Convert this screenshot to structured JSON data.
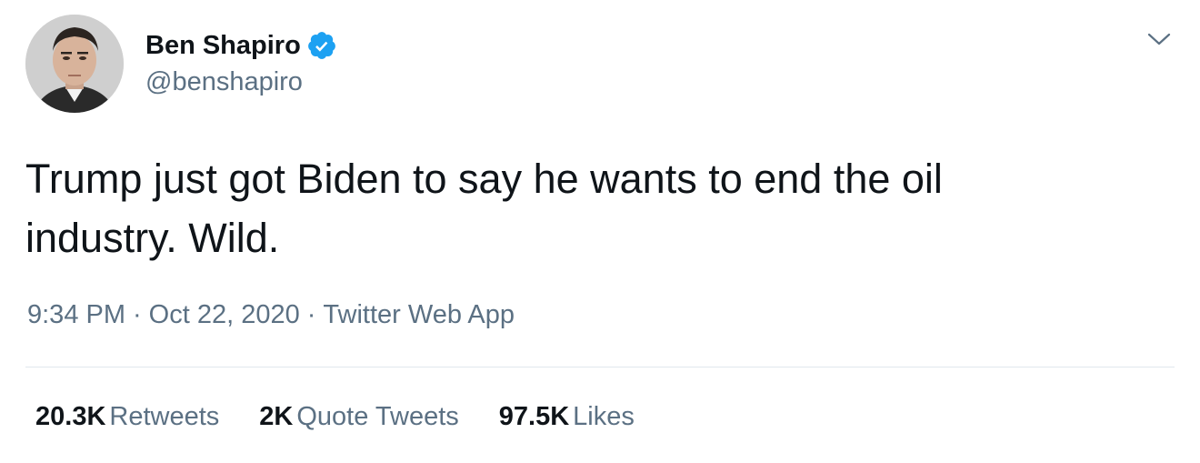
{
  "author": {
    "display_name": "Ben Shapiro",
    "handle": "@benshapiro",
    "verified": true,
    "avatar_icon": "profile-photo"
  },
  "tweet": {
    "text": "Trump just got Biden to say he wants to end the oil\nindustry. Wild.",
    "time": "9:34 PM",
    "date": "Oct 22, 2020",
    "source": "Twitter Web App",
    "separator": "·"
  },
  "stats": {
    "retweets": {
      "count": "20.3K",
      "label": "Retweets"
    },
    "quote_tweets": {
      "count": "2K",
      "label": "Quote Tweets"
    },
    "likes": {
      "count": "97.5K",
      "label": "Likes"
    }
  },
  "icons": {
    "verified": "verified-badge-icon",
    "more": "chevron-down-icon"
  },
  "colors": {
    "text_primary": "#0f1419",
    "text_secondary": "#5b7083",
    "verified_blue": "#1da1f2",
    "divider": "#e1e8ed"
  }
}
